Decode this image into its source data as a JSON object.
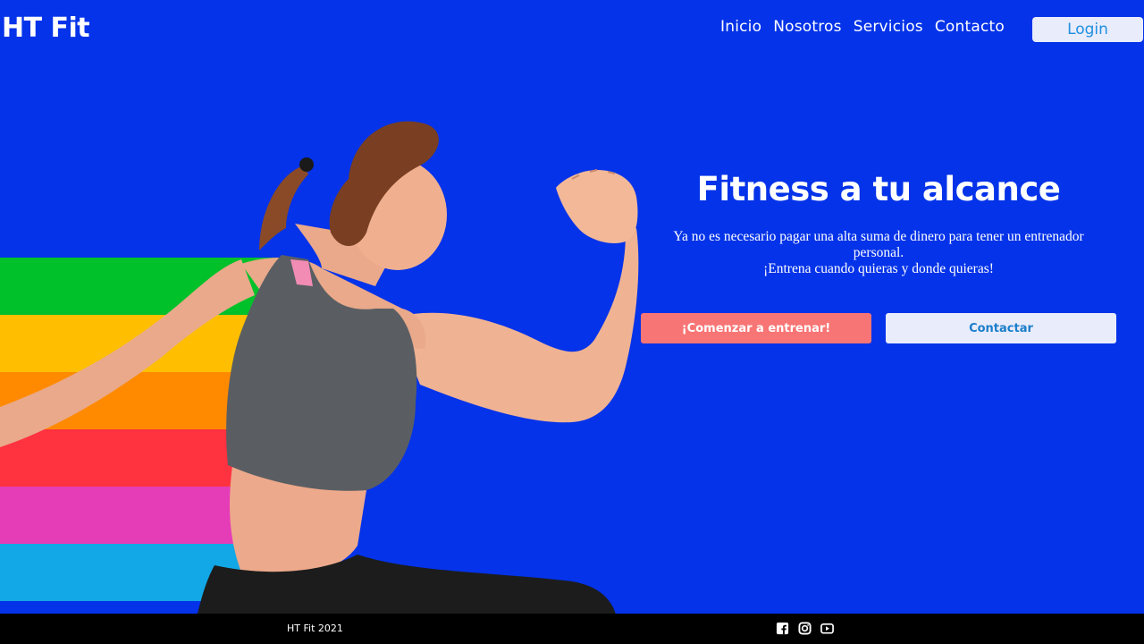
{
  "header": {
    "logo": "HT Fit",
    "nav": [
      "Inicio",
      "Nosotros",
      "Servicios",
      "Contacto"
    ],
    "login_label": "Login"
  },
  "hero": {
    "title": "Fitness a tu alcance",
    "description_line1": "Ya no es necesario pagar una alta suma de dinero para tener un entrenador personal.",
    "description_line2": "¡Entrena cuando quieras y donde quieras!",
    "primary_button": "¡Comenzar a entrenar!",
    "secondary_button": "Contactar"
  },
  "stripes": {
    "colors": [
      "#00c12a",
      "#ffbf00",
      "#ff8a00",
      "#ff3240",
      "#e53cb8",
      "#12a7e6"
    ]
  },
  "footer": {
    "copyright": "HT Fit 2021",
    "social_icons": [
      "facebook-icon",
      "instagram-icon",
      "youtube-icon"
    ]
  },
  "colors": {
    "background": "#0433e9",
    "primary_button": "#f87575",
    "secondary_button": "#e9ecfb",
    "footer": "#000000"
  }
}
